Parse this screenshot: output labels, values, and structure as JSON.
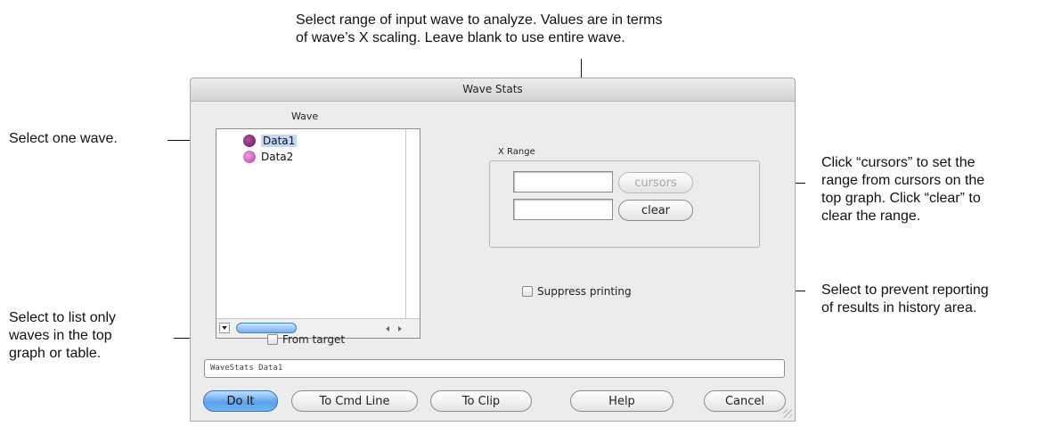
{
  "annotations": {
    "top": [
      "Select range of input wave to analyze. Values are in terms",
      "of wave’s X scaling. Leave blank to use entire wave."
    ],
    "select_wave": "Select one wave.",
    "list_only": [
      "Select to list only",
      "waves in the top",
      "graph or table."
    ],
    "cursors": [
      "Click “cursors” to set the",
      "range from cursors on the",
      "top graph. Click “clear” to",
      "clear the range."
    ],
    "suppress": [
      "Select to prevent reporting",
      "of results in history area."
    ]
  },
  "dialog": {
    "title": "Wave Stats",
    "wave_label": "Wave",
    "waves": [
      {
        "name": "Data1",
        "selected": true,
        "icon_color": "#7a2f6e"
      },
      {
        "name": "Data2",
        "selected": false,
        "icon_color": "#c04fb0"
      }
    ],
    "x_range_label": "X Range",
    "x_range_start": "",
    "x_range_end": "",
    "cursors_label": "cursors",
    "clear_label": "clear",
    "suppress_printing_label": "Suppress printing",
    "suppress_printing_checked": false,
    "from_target_label": "From target",
    "from_target_checked": false,
    "command_line": "WaveStats Data1",
    "buttons": {
      "do_it": "Do It",
      "to_cmd_line": "To Cmd Line",
      "to_clip": "To Clip",
      "help": "Help",
      "cancel": "Cancel"
    }
  }
}
